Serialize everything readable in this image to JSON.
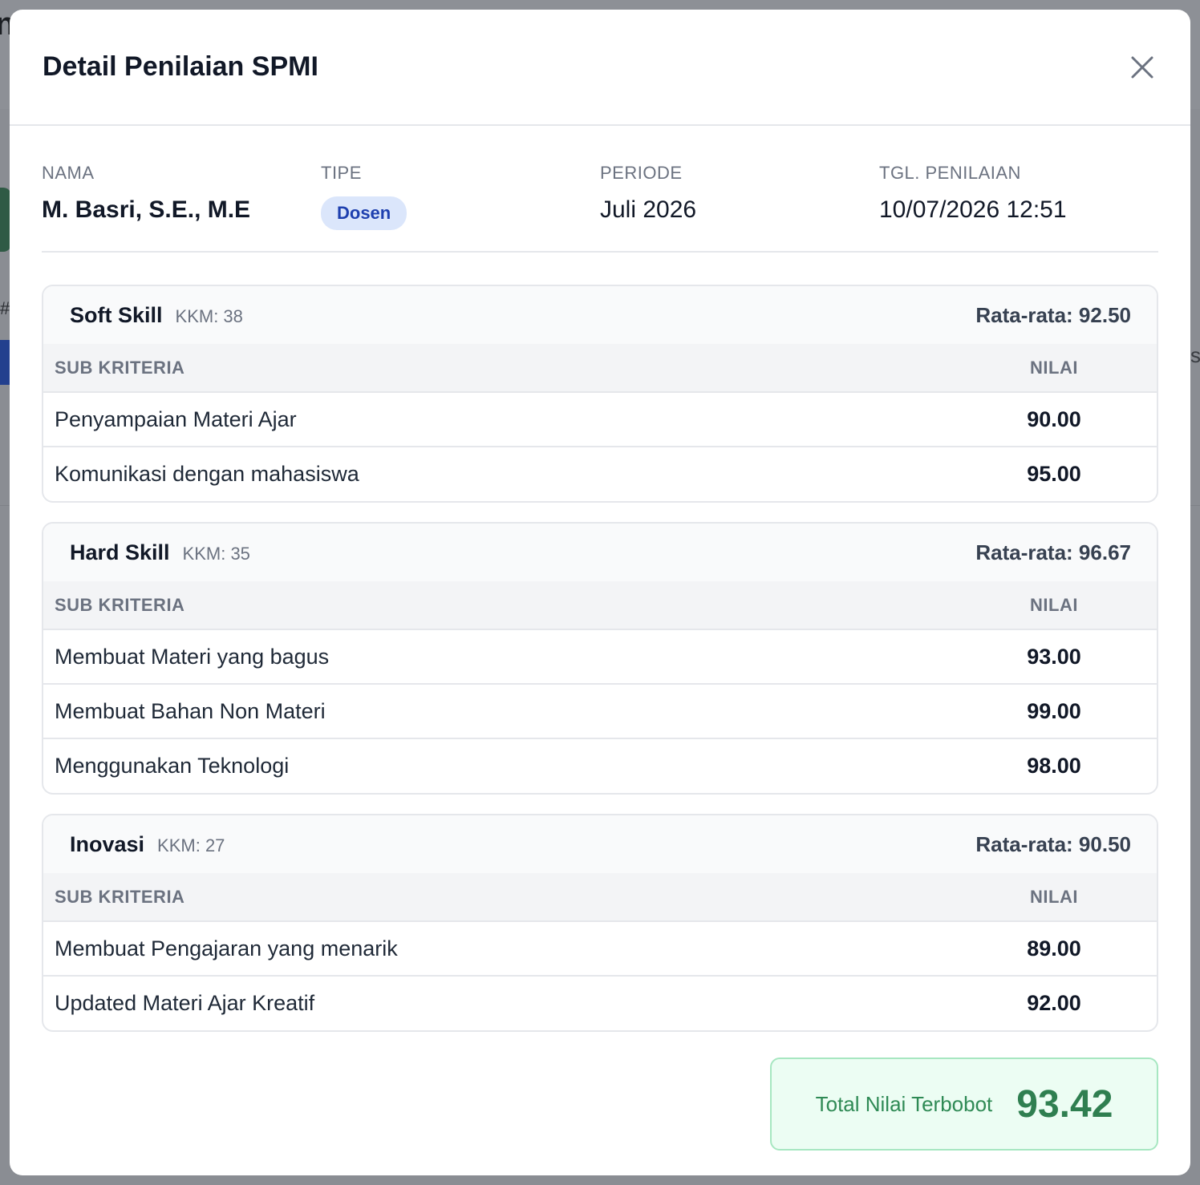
{
  "background": {
    "left_text": "n",
    "hash": "#",
    "right_text": "sa"
  },
  "modal": {
    "title": "Detail Penilaian SPMI",
    "close_icon": "close-icon"
  },
  "info": {
    "nama_label": "NAMA",
    "nama_value": "M. Basri, S.E., M.E",
    "tipe_label": "TIPE",
    "tipe_value": "Dosen",
    "periode_label": "PERIODE",
    "periode_value": "Juli 2026",
    "tgl_label": "TGL. PENILAIAN",
    "tgl_value": "10/07/2026 12:51"
  },
  "sections": [
    {
      "title": "Soft Skill",
      "kkm": "KKM: 38",
      "avg": "Rata-rata: 92.50",
      "col_sub": "SUB KRITERIA",
      "col_nilai": "NILAI",
      "rows": [
        {
          "name": "Penyampaian Materi Ajar",
          "nilai": "90.00"
        },
        {
          "name": "Komunikasi dengan mahasiswa",
          "nilai": "95.00"
        }
      ]
    },
    {
      "title": "Hard Skill",
      "kkm": "KKM: 35",
      "avg": "Rata-rata: 96.67",
      "col_sub": "SUB KRITERIA",
      "col_nilai": "NILAI",
      "rows": [
        {
          "name": "Membuat Materi yang bagus",
          "nilai": "93.00"
        },
        {
          "name": "Membuat Bahan Non Materi",
          "nilai": "99.00"
        },
        {
          "name": "Menggunakan Teknologi",
          "nilai": "98.00"
        }
      ]
    },
    {
      "title": "Inovasi",
      "kkm": "KKM: 27",
      "avg": "Rata-rata: 90.50",
      "col_sub": "SUB KRITERIA",
      "col_nilai": "NILAI",
      "rows": [
        {
          "name": "Membuat Pengajaran yang menarik",
          "nilai": "89.00"
        },
        {
          "name": "Updated Materi Ajar Kreatif",
          "nilai": "92.00"
        }
      ]
    }
  ],
  "total": {
    "label": "Total Nilai Terbobot",
    "value": "93.42"
  },
  "colors": {
    "badge_bg": "#dbe6fb",
    "badge_text": "#1e40af",
    "total_bg": "#ecfdf3",
    "total_text": "#2f7f50"
  }
}
